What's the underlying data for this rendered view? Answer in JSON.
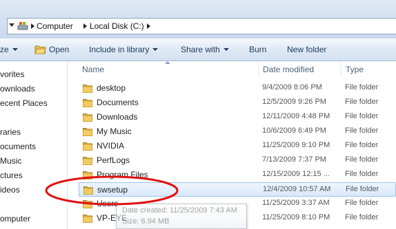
{
  "address_bar": {
    "breadcrumbs": [
      "Computer",
      "Local Disk (C:)"
    ]
  },
  "toolbar": {
    "organize_partial": "ze",
    "open_label": "Open",
    "include_label": "Include in library",
    "share_label": "Share with",
    "burn_label": "Burn",
    "new_folder_label": "New folder"
  },
  "nav_pane": {
    "items": [
      {
        "label": "vorites",
        "icon": "star-icon"
      },
      {
        "label": "ownloads",
        "icon": "downloads-folder-icon"
      },
      {
        "label": "ecent Places",
        "icon": "recent-places-icon"
      },
      {
        "label": "raries",
        "icon": "libraries-icon"
      },
      {
        "label": "ocuments",
        "icon": "documents-icon"
      },
      {
        "label": "Music",
        "icon": "music-icon"
      },
      {
        "label": "ctures",
        "icon": "pictures-icon"
      },
      {
        "label": "ideos",
        "icon": "videos-icon"
      },
      {
        "label": "omputer",
        "icon": "computer-icon"
      }
    ]
  },
  "columns": {
    "name": "Name",
    "date": "Date modified",
    "type": "Type"
  },
  "files": [
    {
      "name": "desktop",
      "date": "9/4/2009 8:06 PM",
      "type": "File folder"
    },
    {
      "name": "Documents",
      "date": "12/5/2009 9:26 PM",
      "type": "File folder"
    },
    {
      "name": "Downloads",
      "date": "12/11/2009 4:48 PM",
      "type": "File folder"
    },
    {
      "name": "My Music",
      "date": "10/6/2009 6:49 PM",
      "type": "File folder"
    },
    {
      "name": "NVIDIA",
      "date": "11/25/2009 9:10 PM",
      "type": "File folder"
    },
    {
      "name": "PerfLogs",
      "date": "7/13/2009 7:37 PM",
      "type": "File folder"
    },
    {
      "name": "Program Files",
      "date": "12/15/2009 12:15 ...",
      "type": "File folder"
    },
    {
      "name": "swsetup",
      "date": "12/4/2009 10:57 AM",
      "type": "File folder",
      "selected": true
    },
    {
      "name": "Users",
      "date": "11/25/2009 3:37 AM",
      "type": "File folder"
    },
    {
      "name": "VP-EYE",
      "date": "11/25/2009 8:10 PM",
      "type": "File folder"
    }
  ],
  "tooltip": {
    "line1": "Date created: 11/25/2009 7:43 AM",
    "line2": "Size: 6.94 MB"
  },
  "colors": {
    "highlight_ellipse": "#e01010",
    "selection": "#cce4fb",
    "folder": "#e8c15a"
  }
}
